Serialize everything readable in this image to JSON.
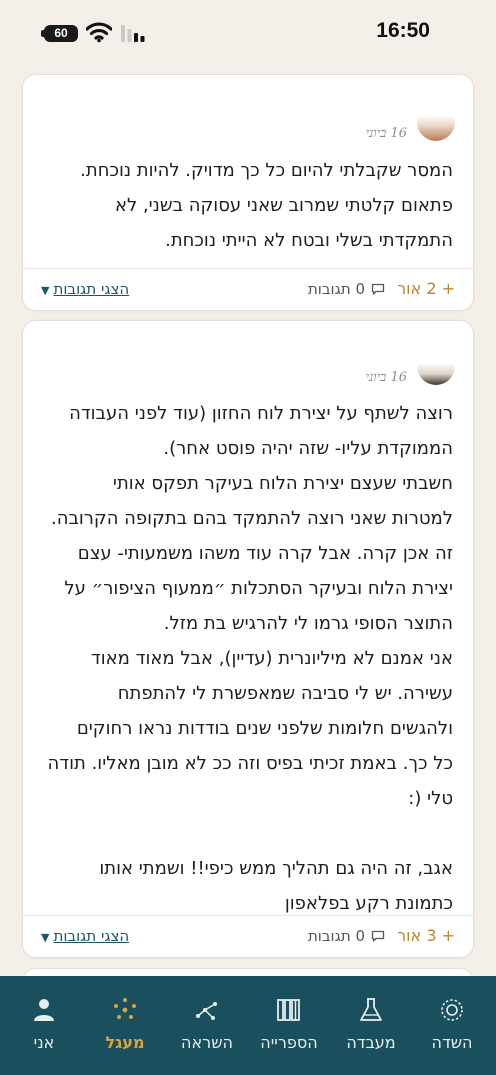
{
  "status_bar": {
    "time": "16:50",
    "battery": "60"
  },
  "posts": [
    {
      "date": "16 ביוני",
      "text": "המסר שקבלתי להיום כל כך מדויק. להיות נוכחת.\nפתאום קלטתי שמרוב שאני עסוקה בשני, לא\nהתמקדתי בשלי ובטח לא הייתי נוכחת.",
      "light": "+ 2 אור",
      "comments": "0 תגובות",
      "show_comments": "הצגי תגובות"
    },
    {
      "date": "16 ביוני",
      "text": "רוצה לשתף על יצירת לוח החזון (עוד לפני העבודה\nהממוקדת עליו- שזה יהיה פוסט אחר).\nחשבתי שעצם יצירת הלוח בעיקר תפקס אותי\nלמטרות שאני רוצה להתמקד בהם בתקופה הקרובה.\nזה אכן קרה. אבל קרה עוד משהו משמעותי- עצם\nיצירת הלוח ובעיקר הסתכלות ״ממעוף הציפור״ על\nהתוצר הסופי גרמו לי להרגיש בת מזל.\nאני אמנם לא מיליונרית (עדיין), אבל מאוד מאוד\nעשירה. יש לי סביבה שמאפשרת לי להתפתח\nולהגשים חלומות שלפני שנים בודדות נראו רחוקים\nכל כך. באמת זכיתי בפיס וזה ככ לא מובן מאליו. תודה\nטלי (:\n\nאגב, זה היה גם תהליך ממש כיפי!! ושמתי אותו\nכתמונת רקע בפלאפון",
      "light": "+ 3 אור",
      "comments": "0 תגובות",
      "show_comments": "הצגי תגובות"
    }
  ],
  "nav": {
    "items": [
      {
        "label": "אני",
        "icon": "person-icon"
      },
      {
        "label": "מעגל",
        "icon": "circle-dots-icon",
        "active": true
      },
      {
        "label": "השראה",
        "icon": "constellation-icon"
      },
      {
        "label": "הספרייה",
        "icon": "books-icon"
      },
      {
        "label": "מעבדה",
        "icon": "flask-icon"
      },
      {
        "label": "השדה",
        "icon": "field-icon"
      }
    ]
  },
  "colors": {
    "nav_background": "#1a4f5d",
    "accent": "#d9a441",
    "link": "#1d5566",
    "light_button": "#b8872c"
  }
}
